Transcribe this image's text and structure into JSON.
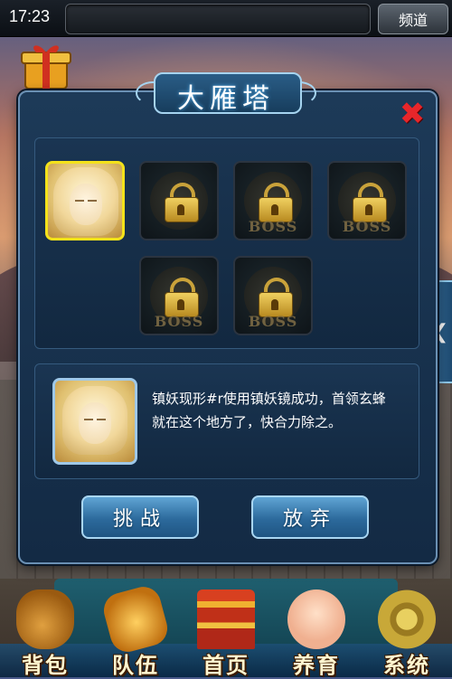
{
  "status_bar": {
    "time": "17:23",
    "chat_placeholder": "",
    "channel_button": "频道"
  },
  "dialog": {
    "title": "大雁塔",
    "close_icon": "close-x-icon",
    "stages": [
      {
        "state": "unlocked",
        "boss": false
      },
      {
        "state": "locked",
        "boss": false
      },
      {
        "state": "locked",
        "boss": true,
        "boss_label": "BOSS"
      },
      {
        "state": "locked",
        "boss": true,
        "boss_label": "BOSS"
      },
      {
        "state": "locked",
        "boss": true,
        "boss_label": "BOSS"
      },
      {
        "state": "locked",
        "boss": true,
        "boss_label": "BOSS"
      }
    ],
    "description_line1": "镇妖现形#r使用镇妖镜成功，首领玄蜂",
    "description_line2": "就在这个地方了，快合力除之。",
    "challenge_button": "挑战",
    "abandon_button": "放弃"
  },
  "side_tab_icon": "chevron-left-icon",
  "bottom_nav": [
    {
      "label": "背包",
      "icon": "bag-icon"
    },
    {
      "label": "队伍",
      "icon": "team-icon"
    },
    {
      "label": "首页",
      "icon": "home-pagoda-icon"
    },
    {
      "label": "养育",
      "icon": "raise-child-icon"
    },
    {
      "label": "系统",
      "icon": "gear-icon"
    }
  ],
  "colors": {
    "accent_blue": "#2c6a9c",
    "selected_border": "#f4e21a",
    "close_red": "#e8262a"
  }
}
